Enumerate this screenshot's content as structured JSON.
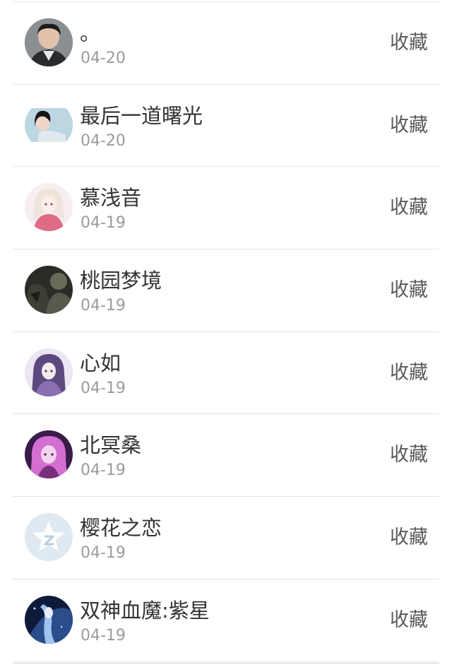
{
  "action_label": "收藏",
  "items": [
    {
      "name": "。",
      "date": "04-20",
      "avatar": "avatar-man-icon"
    },
    {
      "name": "最后一道曙光",
      "date": "04-20",
      "avatar": "avatar-woman-icon"
    },
    {
      "name": "慕浅音",
      "date": "04-19",
      "avatar": "avatar-anime-pink-icon"
    },
    {
      "name": "桃园梦境",
      "date": "04-19",
      "avatar": "avatar-dark-photo-icon"
    },
    {
      "name": "心如",
      "date": "04-19",
      "avatar": "avatar-anime-purple-icon"
    },
    {
      "name": "北冥桑",
      "date": "04-19",
      "avatar": "avatar-anime-violet-icon"
    },
    {
      "name": "樱花之恋",
      "date": "04-19",
      "avatar": "qq-star-icon"
    },
    {
      "name": "双神血魔:紫星",
      "date": "04-19",
      "avatar": "avatar-anime-blue-icon"
    }
  ]
}
